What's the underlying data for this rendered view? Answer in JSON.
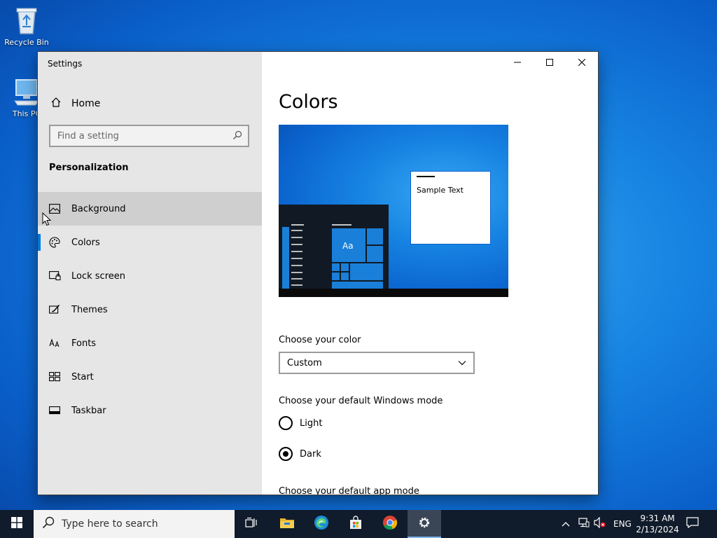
{
  "desktop": {
    "icons": [
      {
        "label": "Recycle Bin",
        "icon": "recycle-bin-icon"
      },
      {
        "label": "This PC",
        "icon": "computer-icon"
      }
    ]
  },
  "window": {
    "title": "Settings",
    "controls": {
      "minimize": "minimize-icon",
      "maximize": "maximize-icon",
      "close": "close-icon"
    }
  },
  "nav": {
    "home_label": "Home",
    "search_placeholder": "Find a setting",
    "section": "Personalization",
    "items": [
      {
        "label": "Background",
        "icon": "image-icon",
        "state": "hover"
      },
      {
        "label": "Colors",
        "icon": "palette-icon",
        "state": "selected"
      },
      {
        "label": "Lock screen",
        "icon": "lock-screen-icon",
        "state": "normal"
      },
      {
        "label": "Themes",
        "icon": "brush-icon",
        "state": "normal"
      },
      {
        "label": "Fonts",
        "icon": "fonts-icon",
        "state": "normal"
      },
      {
        "label": "Start",
        "icon": "start-layout-icon",
        "state": "normal"
      },
      {
        "label": "Taskbar",
        "icon": "taskbar-icon",
        "state": "normal"
      }
    ]
  },
  "content": {
    "title": "Colors",
    "preview": {
      "sample_text": "Sample Text",
      "tile_text": "Aa"
    },
    "choose_color_label": "Choose your color",
    "color_select_value": "Custom",
    "windows_mode_label": "Choose your default Windows mode",
    "windows_mode_options": [
      {
        "label": "Light",
        "checked": false
      },
      {
        "label": "Dark",
        "checked": true
      }
    ],
    "app_mode_label": "Choose your default app mode"
  },
  "taskbar": {
    "search_placeholder": "Type here to search",
    "apps": [
      "task-view-icon",
      "file-explorer-icon",
      "edge-icon",
      "store-icon",
      "chrome-icon",
      "settings-icon"
    ],
    "tray": {
      "language": "ENG",
      "time": "9:31 AM",
      "date": "2/13/2024"
    }
  },
  "colors": {
    "accent": "#0078d7",
    "nav_background": "#e6e6e6",
    "taskbar_background": "#101b2b",
    "hover_background": "#cfcfcf"
  }
}
